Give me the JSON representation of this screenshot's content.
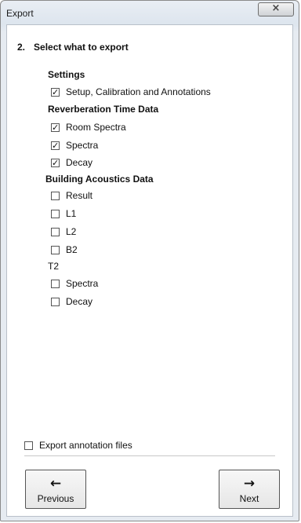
{
  "window": {
    "title": "Export",
    "close_glyph": "×"
  },
  "step": {
    "number": "2.",
    "title": "Select what to export"
  },
  "groups": {
    "settings": {
      "title": "Settings",
      "items": [
        {
          "label": "Setup, Calibration and Annotations",
          "checked": true
        }
      ]
    },
    "reverberation": {
      "title": "Reverberation Time Data",
      "items": [
        {
          "label": "Room Spectra",
          "checked": true
        },
        {
          "label": "Spectra",
          "checked": true
        },
        {
          "label": "Decay",
          "checked": true
        }
      ]
    },
    "building": {
      "title": "Building Acoustics Data",
      "items": [
        {
          "label": "Result",
          "checked": false
        },
        {
          "label": "L1",
          "checked": false
        },
        {
          "label": "L2",
          "checked": false
        },
        {
          "label": "B2",
          "checked": false
        }
      ]
    },
    "t2": {
      "title": "T2",
      "items": [
        {
          "label": "Spectra",
          "checked": false
        },
        {
          "label": "Decay",
          "checked": false
        }
      ]
    }
  },
  "export_annotation": {
    "label": "Export annotation files",
    "checked": false
  },
  "buttons": {
    "previous": {
      "label": "Previous",
      "arrow": "←"
    },
    "next": {
      "label": "Next",
      "arrow": "→"
    }
  },
  "icons": {
    "checkmark": "✓"
  }
}
